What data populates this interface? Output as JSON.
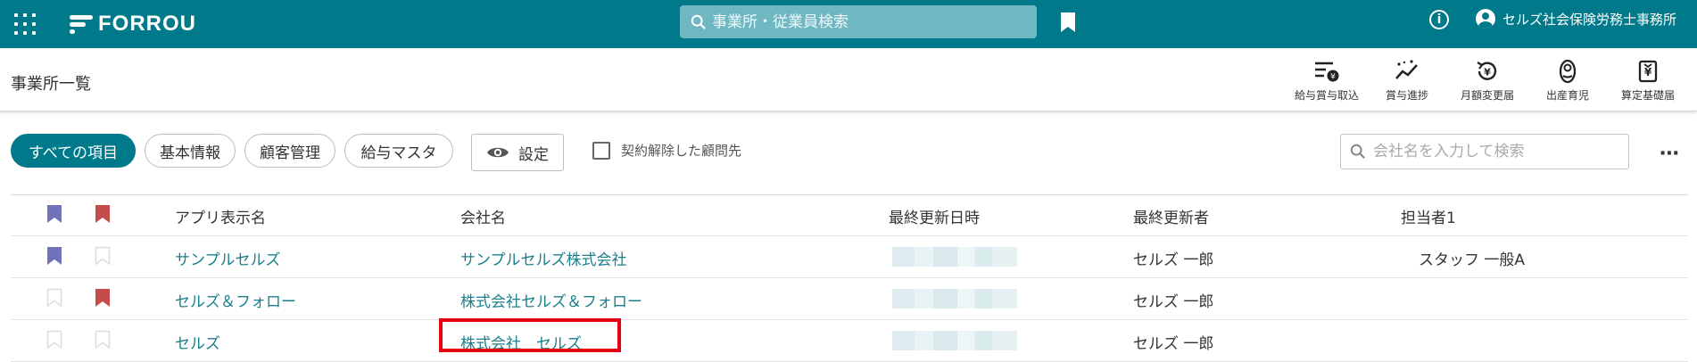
{
  "header": {
    "logo_text": "FORROU",
    "search_placeholder": "事業所・従業員検索",
    "account_name": "セルズ社会保険労務士事務所",
    "bg_color": "#007a8a"
  },
  "page": {
    "title": "事業所一覧"
  },
  "toolbar": [
    {
      "label": "給与賞与取込",
      "icon": "payroll-import-icon"
    },
    {
      "label": "賞与進捗",
      "icon": "bonus-progress-icon"
    },
    {
      "label": "月額変更届",
      "icon": "monthly-change-icon"
    },
    {
      "label": "出産育児",
      "icon": "childbirth-icon"
    },
    {
      "label": "算定基礎届",
      "icon": "calculation-base-icon"
    }
  ],
  "filters": {
    "chips": [
      "すべての項目",
      "基本情報",
      "顧客管理",
      "給与マスタ"
    ],
    "active_chip": "すべての項目",
    "settings_label": "設定",
    "cancel_label": "契約解除した顧問先",
    "cancel_checked": false,
    "company_search_placeholder": "会社名を入力して検索"
  },
  "table": {
    "columns": [
      "アプリ表示名",
      "会社名",
      "最終更新日時",
      "最終更新者",
      "担当者1"
    ],
    "rows": [
      {
        "app_name": "サンプルセルズ",
        "company": "サンプルセルズ株式会社",
        "updater": "セルズ 一郎",
        "assignee": "スタッフ 一般A",
        "bookmark_purple": true,
        "bookmark_red": false
      },
      {
        "app_name": "セルズ＆フォロー",
        "company": "株式会社セルズ＆フォロー",
        "updater": "セルズ 一郎",
        "assignee": "",
        "bookmark_purple": false,
        "bookmark_red": true
      },
      {
        "app_name": "セルズ",
        "company": "株式会社　セルズ",
        "updater": "セルズ 一郎",
        "assignee": "",
        "bookmark_purple": false,
        "bookmark_red": false
      }
    ]
  },
  "colors": {
    "accent": "#007a8a",
    "bookmark_purple": "#7073b8",
    "bookmark_red": "#c64b4b",
    "highlight_red": "#e60012"
  }
}
